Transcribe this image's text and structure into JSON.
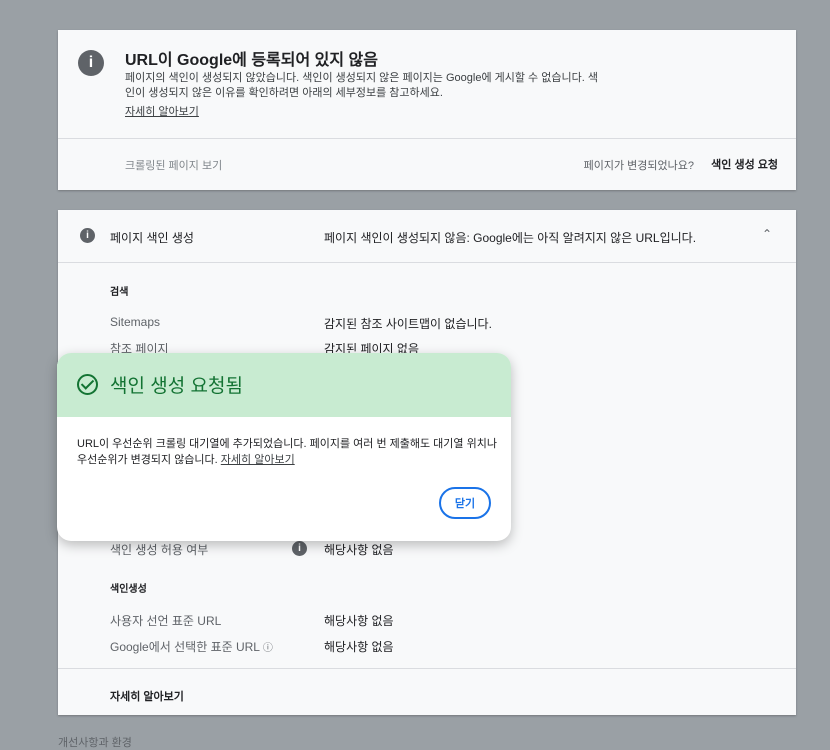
{
  "status_card": {
    "title": "URL이 Google에 등록되어 있지 않음",
    "description": "페이지의 색인이 생성되지 않았습니다. 색인이 생성되지 않은 페이지는 Google에 게시할 수 없습니다. 색인이 생성되지 않은 이유를 확인하려면 아래의 세부정보를 참고하세요.",
    "learn_more": "자세히 알아보기",
    "view_crawled": "크롤링된 페이지 보기",
    "page_changed": "페이지가 변경되었나요?",
    "request_indexing": "색인 생성 요청"
  },
  "indexing_card": {
    "header_label": "페이지 색인 생성",
    "header_value": "페이지 색인이 생성되지 않음: Google에는 아직 알려지지 않은 URL입니다.",
    "discovery_title": "검색",
    "sitemaps_label": "Sitemaps",
    "sitemaps_value": "감지된 참조 사이트맵이 없습니다.",
    "referring_label": "참조 페이지",
    "referring_value": "감지된 페이지 없음",
    "index_allowed_label": "색인 생성 허용 여부",
    "index_allowed_value": "해당사항 없음",
    "indexing_title": "색인생성",
    "user_canonical_label": "사용자 선언 표준 URL",
    "user_canonical_value": "해당사항 없음",
    "google_canonical_label": "Google에서 선택한 표준 URL",
    "google_canonical_value": "해당사항 없음",
    "learn_more": "자세히 알아보기"
  },
  "bottom_text": "개선사항과 환경",
  "dialog": {
    "title": "색인 생성 요청됨",
    "body": "URL이 우선순위 크롤링 대기열에 추가되었습니다. 페이지를 여러 번 제출해도 대기열 위치나 우선순위가 변경되지 않습니다.",
    "learn_more": "자세히 알아보기",
    "close": "닫기"
  },
  "colors": {
    "overlay": "#9aa0a5",
    "dialog_header": "#c8ebd1",
    "success": "#137333",
    "accent": "#1a73e8"
  },
  "icons": [
    "info-icon",
    "chevron-up-icon",
    "help-icon",
    "check-circle-icon"
  ]
}
